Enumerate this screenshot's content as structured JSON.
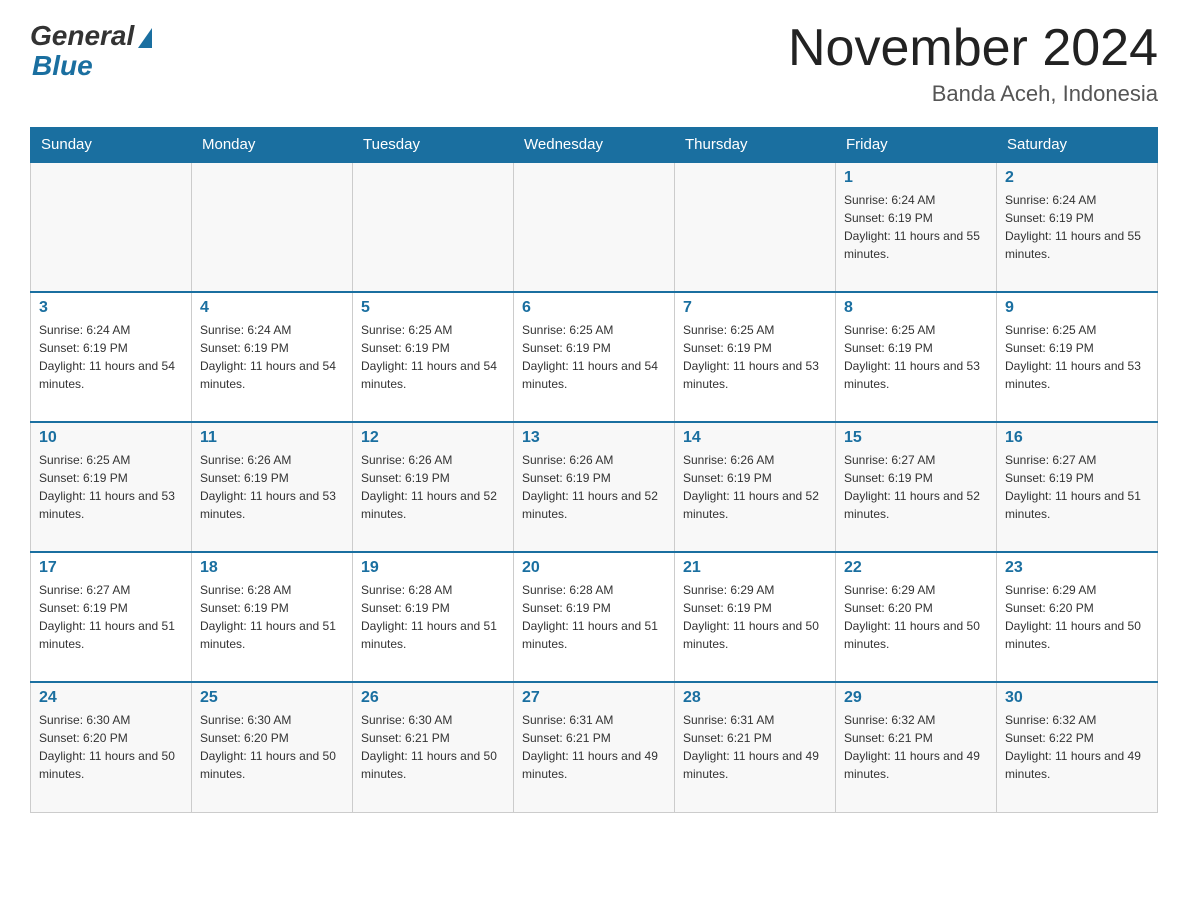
{
  "header": {
    "logo_general": "General",
    "logo_blue": "Blue",
    "title": "November 2024",
    "subtitle": "Banda Aceh, Indonesia"
  },
  "days_of_week": [
    "Sunday",
    "Monday",
    "Tuesday",
    "Wednesday",
    "Thursday",
    "Friday",
    "Saturday"
  ],
  "weeks": [
    {
      "days": [
        {
          "number": "",
          "info": ""
        },
        {
          "number": "",
          "info": ""
        },
        {
          "number": "",
          "info": ""
        },
        {
          "number": "",
          "info": ""
        },
        {
          "number": "",
          "info": ""
        },
        {
          "number": "1",
          "info": "Sunrise: 6:24 AM\nSunset: 6:19 PM\nDaylight: 11 hours and 55 minutes."
        },
        {
          "number": "2",
          "info": "Sunrise: 6:24 AM\nSunset: 6:19 PM\nDaylight: 11 hours and 55 minutes."
        }
      ]
    },
    {
      "days": [
        {
          "number": "3",
          "info": "Sunrise: 6:24 AM\nSunset: 6:19 PM\nDaylight: 11 hours and 54 minutes."
        },
        {
          "number": "4",
          "info": "Sunrise: 6:24 AM\nSunset: 6:19 PM\nDaylight: 11 hours and 54 minutes."
        },
        {
          "number": "5",
          "info": "Sunrise: 6:25 AM\nSunset: 6:19 PM\nDaylight: 11 hours and 54 minutes."
        },
        {
          "number": "6",
          "info": "Sunrise: 6:25 AM\nSunset: 6:19 PM\nDaylight: 11 hours and 54 minutes."
        },
        {
          "number": "7",
          "info": "Sunrise: 6:25 AM\nSunset: 6:19 PM\nDaylight: 11 hours and 53 minutes."
        },
        {
          "number": "8",
          "info": "Sunrise: 6:25 AM\nSunset: 6:19 PM\nDaylight: 11 hours and 53 minutes."
        },
        {
          "number": "9",
          "info": "Sunrise: 6:25 AM\nSunset: 6:19 PM\nDaylight: 11 hours and 53 minutes."
        }
      ]
    },
    {
      "days": [
        {
          "number": "10",
          "info": "Sunrise: 6:25 AM\nSunset: 6:19 PM\nDaylight: 11 hours and 53 minutes."
        },
        {
          "number": "11",
          "info": "Sunrise: 6:26 AM\nSunset: 6:19 PM\nDaylight: 11 hours and 53 minutes."
        },
        {
          "number": "12",
          "info": "Sunrise: 6:26 AM\nSunset: 6:19 PM\nDaylight: 11 hours and 52 minutes."
        },
        {
          "number": "13",
          "info": "Sunrise: 6:26 AM\nSunset: 6:19 PM\nDaylight: 11 hours and 52 minutes."
        },
        {
          "number": "14",
          "info": "Sunrise: 6:26 AM\nSunset: 6:19 PM\nDaylight: 11 hours and 52 minutes."
        },
        {
          "number": "15",
          "info": "Sunrise: 6:27 AM\nSunset: 6:19 PM\nDaylight: 11 hours and 52 minutes."
        },
        {
          "number": "16",
          "info": "Sunrise: 6:27 AM\nSunset: 6:19 PM\nDaylight: 11 hours and 51 minutes."
        }
      ]
    },
    {
      "days": [
        {
          "number": "17",
          "info": "Sunrise: 6:27 AM\nSunset: 6:19 PM\nDaylight: 11 hours and 51 minutes."
        },
        {
          "number": "18",
          "info": "Sunrise: 6:28 AM\nSunset: 6:19 PM\nDaylight: 11 hours and 51 minutes."
        },
        {
          "number": "19",
          "info": "Sunrise: 6:28 AM\nSunset: 6:19 PM\nDaylight: 11 hours and 51 minutes."
        },
        {
          "number": "20",
          "info": "Sunrise: 6:28 AM\nSunset: 6:19 PM\nDaylight: 11 hours and 51 minutes."
        },
        {
          "number": "21",
          "info": "Sunrise: 6:29 AM\nSunset: 6:19 PM\nDaylight: 11 hours and 50 minutes."
        },
        {
          "number": "22",
          "info": "Sunrise: 6:29 AM\nSunset: 6:20 PM\nDaylight: 11 hours and 50 minutes."
        },
        {
          "number": "23",
          "info": "Sunrise: 6:29 AM\nSunset: 6:20 PM\nDaylight: 11 hours and 50 minutes."
        }
      ]
    },
    {
      "days": [
        {
          "number": "24",
          "info": "Sunrise: 6:30 AM\nSunset: 6:20 PM\nDaylight: 11 hours and 50 minutes."
        },
        {
          "number": "25",
          "info": "Sunrise: 6:30 AM\nSunset: 6:20 PM\nDaylight: 11 hours and 50 minutes."
        },
        {
          "number": "26",
          "info": "Sunrise: 6:30 AM\nSunset: 6:21 PM\nDaylight: 11 hours and 50 minutes."
        },
        {
          "number": "27",
          "info": "Sunrise: 6:31 AM\nSunset: 6:21 PM\nDaylight: 11 hours and 49 minutes."
        },
        {
          "number": "28",
          "info": "Sunrise: 6:31 AM\nSunset: 6:21 PM\nDaylight: 11 hours and 49 minutes."
        },
        {
          "number": "29",
          "info": "Sunrise: 6:32 AM\nSunset: 6:21 PM\nDaylight: 11 hours and 49 minutes."
        },
        {
          "number": "30",
          "info": "Sunrise: 6:32 AM\nSunset: 6:22 PM\nDaylight: 11 hours and 49 minutes."
        }
      ]
    }
  ]
}
